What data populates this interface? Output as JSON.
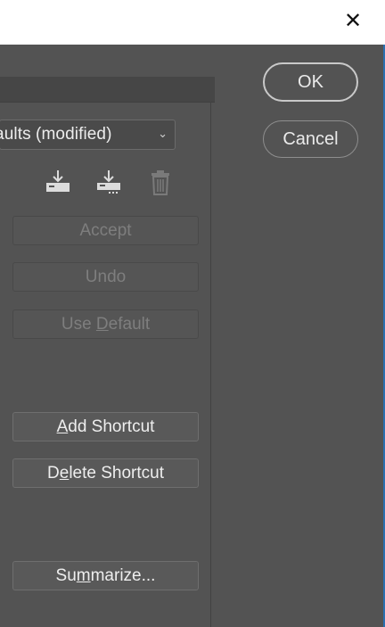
{
  "window": {
    "close_glyph": "✕"
  },
  "keyboard_shortcuts": {
    "set_value": "efaults (modified)",
    "icons": [
      "save-set-icon",
      "save-set-as-icon",
      "delete-set-icon"
    ],
    "buttons": {
      "accept": "Accept",
      "undo": "Undo",
      "use_default": {
        "pre": "Use ",
        "u": "D",
        "post": "efault"
      },
      "add_shortcut": {
        "pre": "",
        "u": "A",
        "post": "dd Shortcut"
      },
      "delete_shortcut": {
        "pre": "D",
        "u": "e",
        "post": "lete Shortcut"
      },
      "summarize": {
        "pre": "Su",
        "u": "m",
        "post": "marize..."
      }
    }
  },
  "dialog_buttons": {
    "ok": "OK",
    "cancel": "Cancel"
  },
  "colors": {
    "panel_bg": "#535353",
    "titlebar_bg": "#ffffff",
    "accent_edge": "#2a6fb0"
  }
}
